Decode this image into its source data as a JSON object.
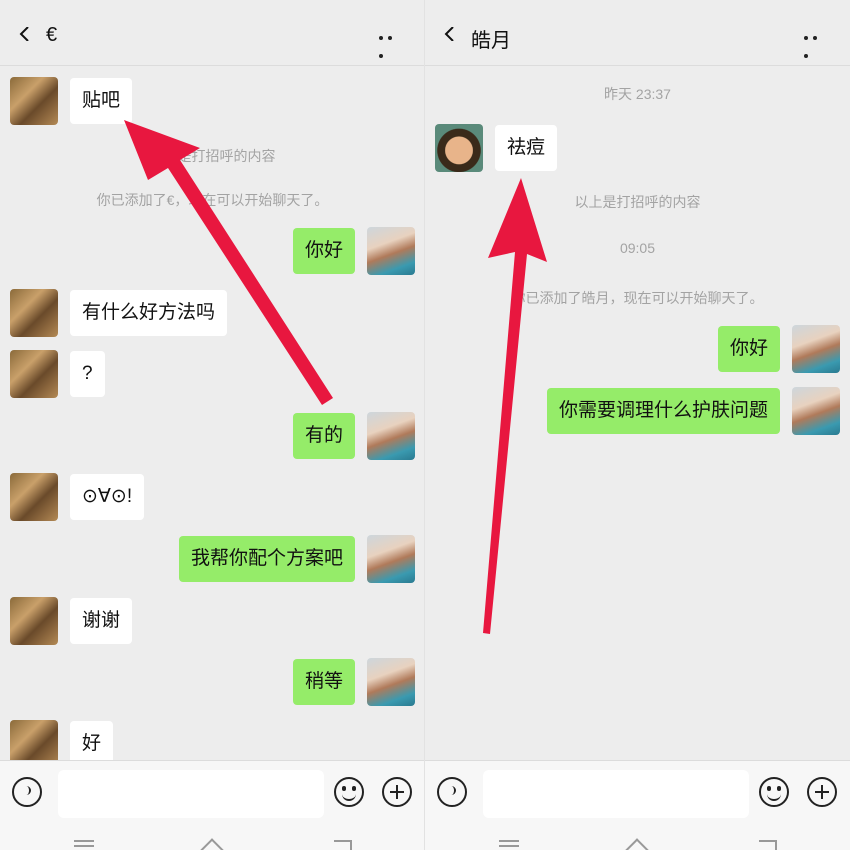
{
  "left": {
    "header": {
      "title": "€"
    },
    "messages": [
      {
        "text": "贴吧"
      },
      {
        "text": "你好"
      },
      {
        "text": "有什么好方法吗"
      },
      {
        "text": "?"
      },
      {
        "text": "有的"
      },
      {
        "text": "⊙∀⊙!"
      },
      {
        "text": "我帮你配个方案吧"
      },
      {
        "text": "谢谢"
      },
      {
        "text": "稍等"
      },
      {
        "text": "好"
      }
    ],
    "system": [
      "以上是打招呼的内容",
      "你已添加了€，现在可以开始聊天了。"
    ]
  },
  "right": {
    "header": {
      "title": "皓月"
    },
    "messages": [
      {
        "text": "祛痘"
      },
      {
        "text": "你好"
      },
      {
        "text": "你需要调理什么护肤问题"
      }
    ],
    "system": [
      "昨天 23:37",
      "以上是打招呼的内容",
      "09:05",
      "你已添加了皓月，现在可以开始聊天了。"
    ]
  },
  "icons": {
    "back": "chevron-left-icon",
    "more": "more-dots-icon",
    "voice": "voice-icon",
    "emoji": "emoji-icon",
    "plus": "plus-icon"
  },
  "colors": {
    "background": "#ededed",
    "bubble_out": "#95ec69",
    "bubble_in": "#ffffff",
    "annotation_arrow": "#e8173f"
  }
}
